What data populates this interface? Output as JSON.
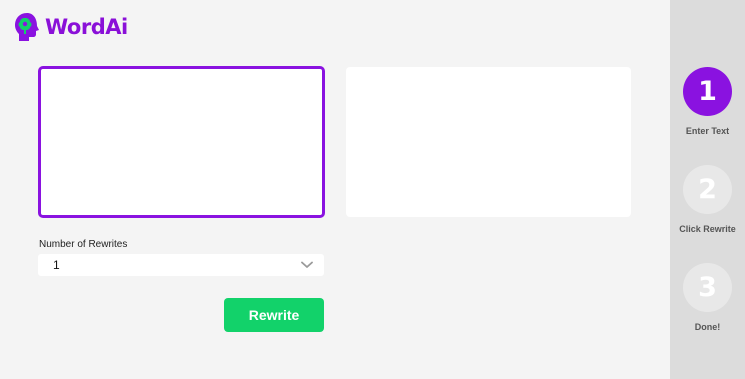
{
  "app": {
    "name": "WordAi"
  },
  "editor": {
    "input_placeholder": "",
    "output_text": ""
  },
  "options": {
    "rewrites_label": "Number of Rewrites",
    "rewrites_value": "1"
  },
  "actions": {
    "rewrite_label": "Rewrite"
  },
  "colors": {
    "brand_purple": "#8a12e0",
    "action_green": "#12d26a",
    "sidebar_bg": "#dcdcdc"
  },
  "steps": [
    {
      "number": "1",
      "label": "Enter Text",
      "state": "active"
    },
    {
      "number": "2",
      "label": "Click Rewrite",
      "state": "inactive"
    },
    {
      "number": "3",
      "label": "Done!",
      "state": "inactive"
    }
  ]
}
